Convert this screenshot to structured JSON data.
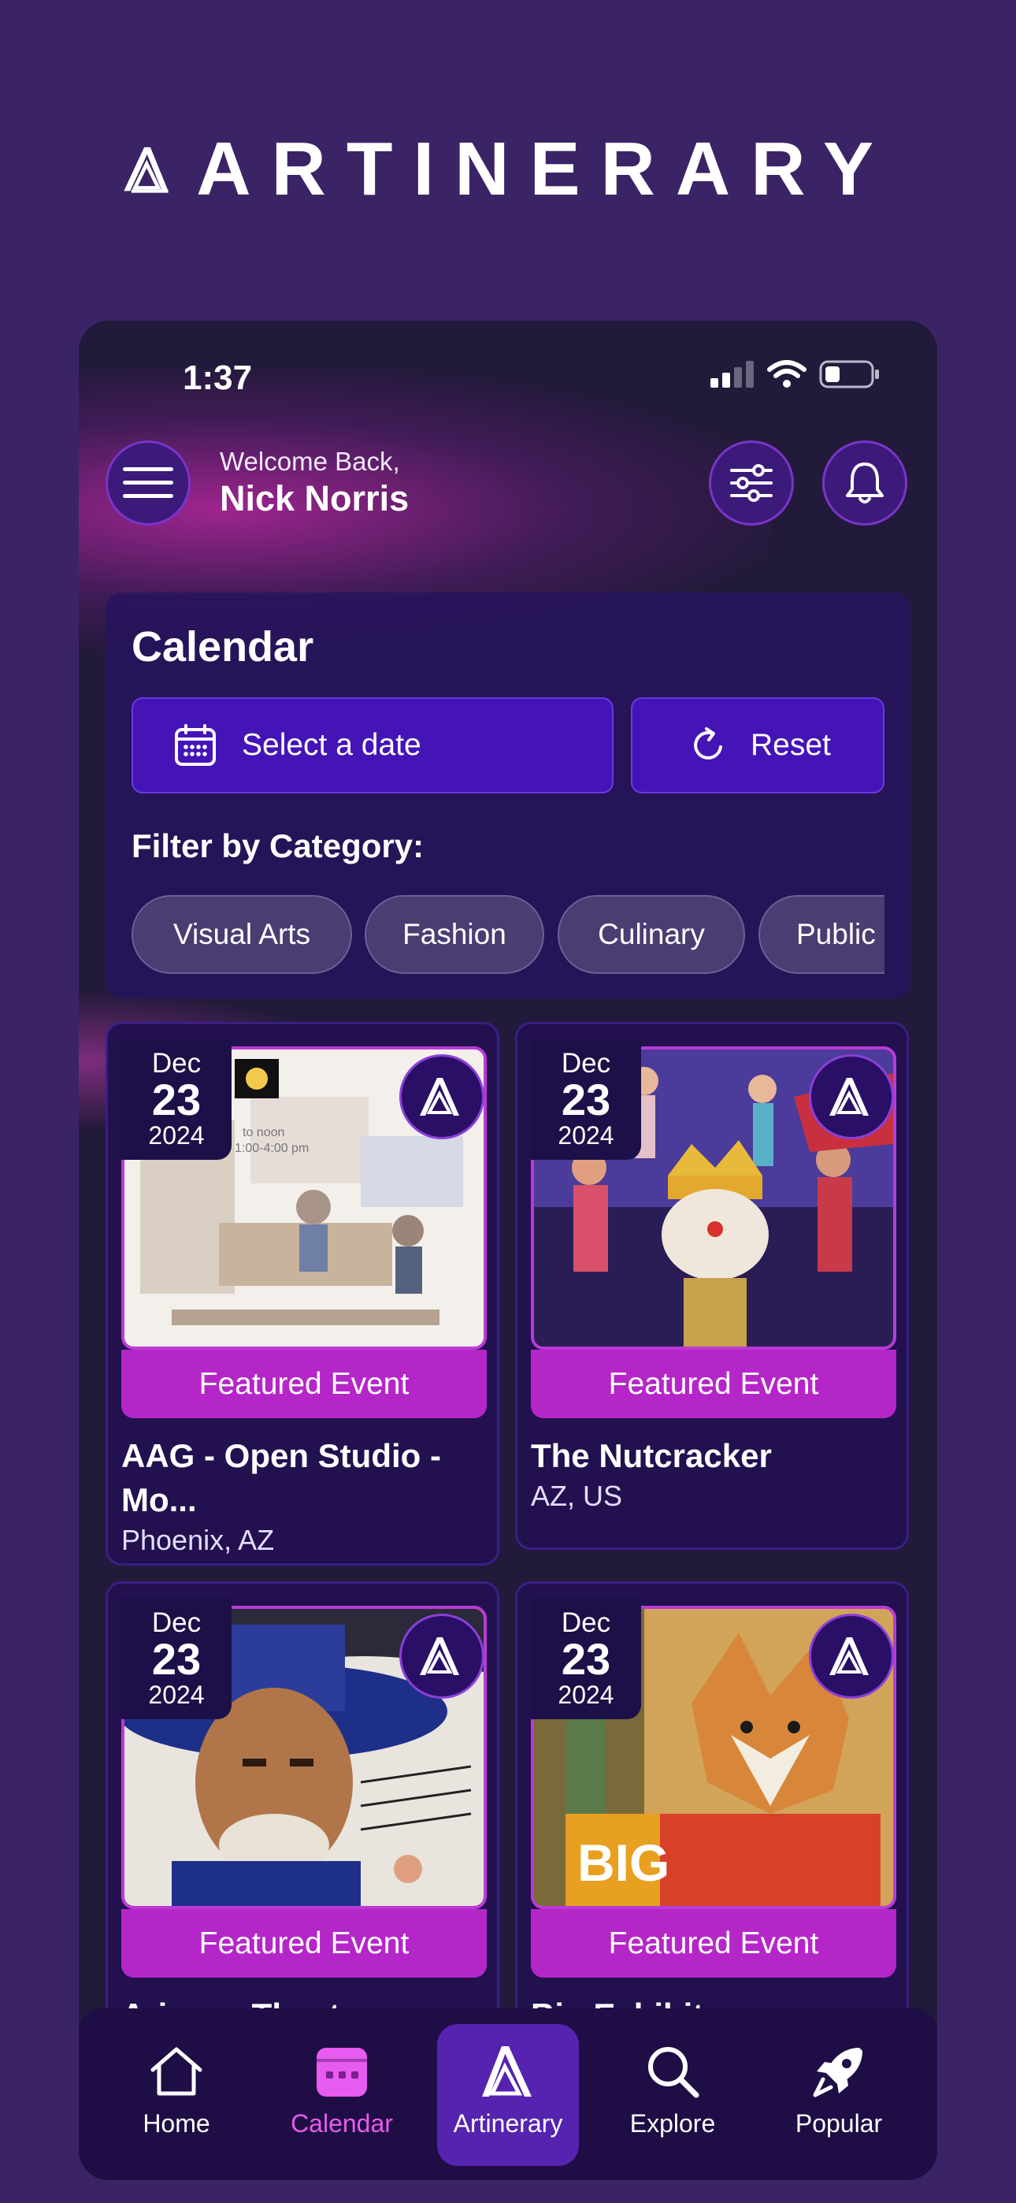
{
  "brand": {
    "name": "ARTINERARY"
  },
  "status_bar": {
    "time": "1:37"
  },
  "header": {
    "welcome": "Welcome Back,",
    "user_name": "Nick Norris"
  },
  "calendar": {
    "title": "Calendar",
    "select_date_label": "Select a date",
    "reset_label": "Reset",
    "filter_label": "Filter by Category:",
    "categories": [
      "Visual Arts",
      "Fashion",
      "Culinary",
      "Public"
    ]
  },
  "events": [
    {
      "month": "Dec",
      "day": "23",
      "year": "2024",
      "badge": "Featured Event",
      "title": "AAG - Open Studio - Mo...",
      "location": "Phoenix, AZ",
      "image": "art-studio-illustration"
    },
    {
      "month": "Dec",
      "day": "23",
      "year": "2024",
      "badge": "Featured Event",
      "title": "The Nutcracker",
      "location": "AZ, US",
      "image": "nutcracker-poster"
    },
    {
      "month": "Dec",
      "day": "23",
      "year": "2024",
      "badge": "Featured Event",
      "title": "Arizona Theatre",
      "location": "",
      "image": "theatre-portrait-illustration"
    },
    {
      "month": "Dec",
      "day": "23",
      "year": "2024",
      "badge": "Featured Event",
      "title": "Big Exhibit",
      "location": "",
      "image": "coyote-exhibit-poster"
    }
  ],
  "tabs": [
    {
      "label": "Home",
      "icon": "home-icon"
    },
    {
      "label": "Calendar",
      "icon": "calendar-icon"
    },
    {
      "label": "Artinerary",
      "icon": "artinerary-logo-icon"
    },
    {
      "label": "Explore",
      "icon": "search-icon"
    },
    {
      "label": "Popular",
      "icon": "rocket-icon"
    }
  ],
  "colors": {
    "page_bg": "#3b2466",
    "phone_bg": "#221a3a",
    "button_purple": "#4514b6",
    "featured_magenta": "#b526c8",
    "active_tab_pink": "#e85bf0",
    "active_pill": "#5523b0"
  }
}
